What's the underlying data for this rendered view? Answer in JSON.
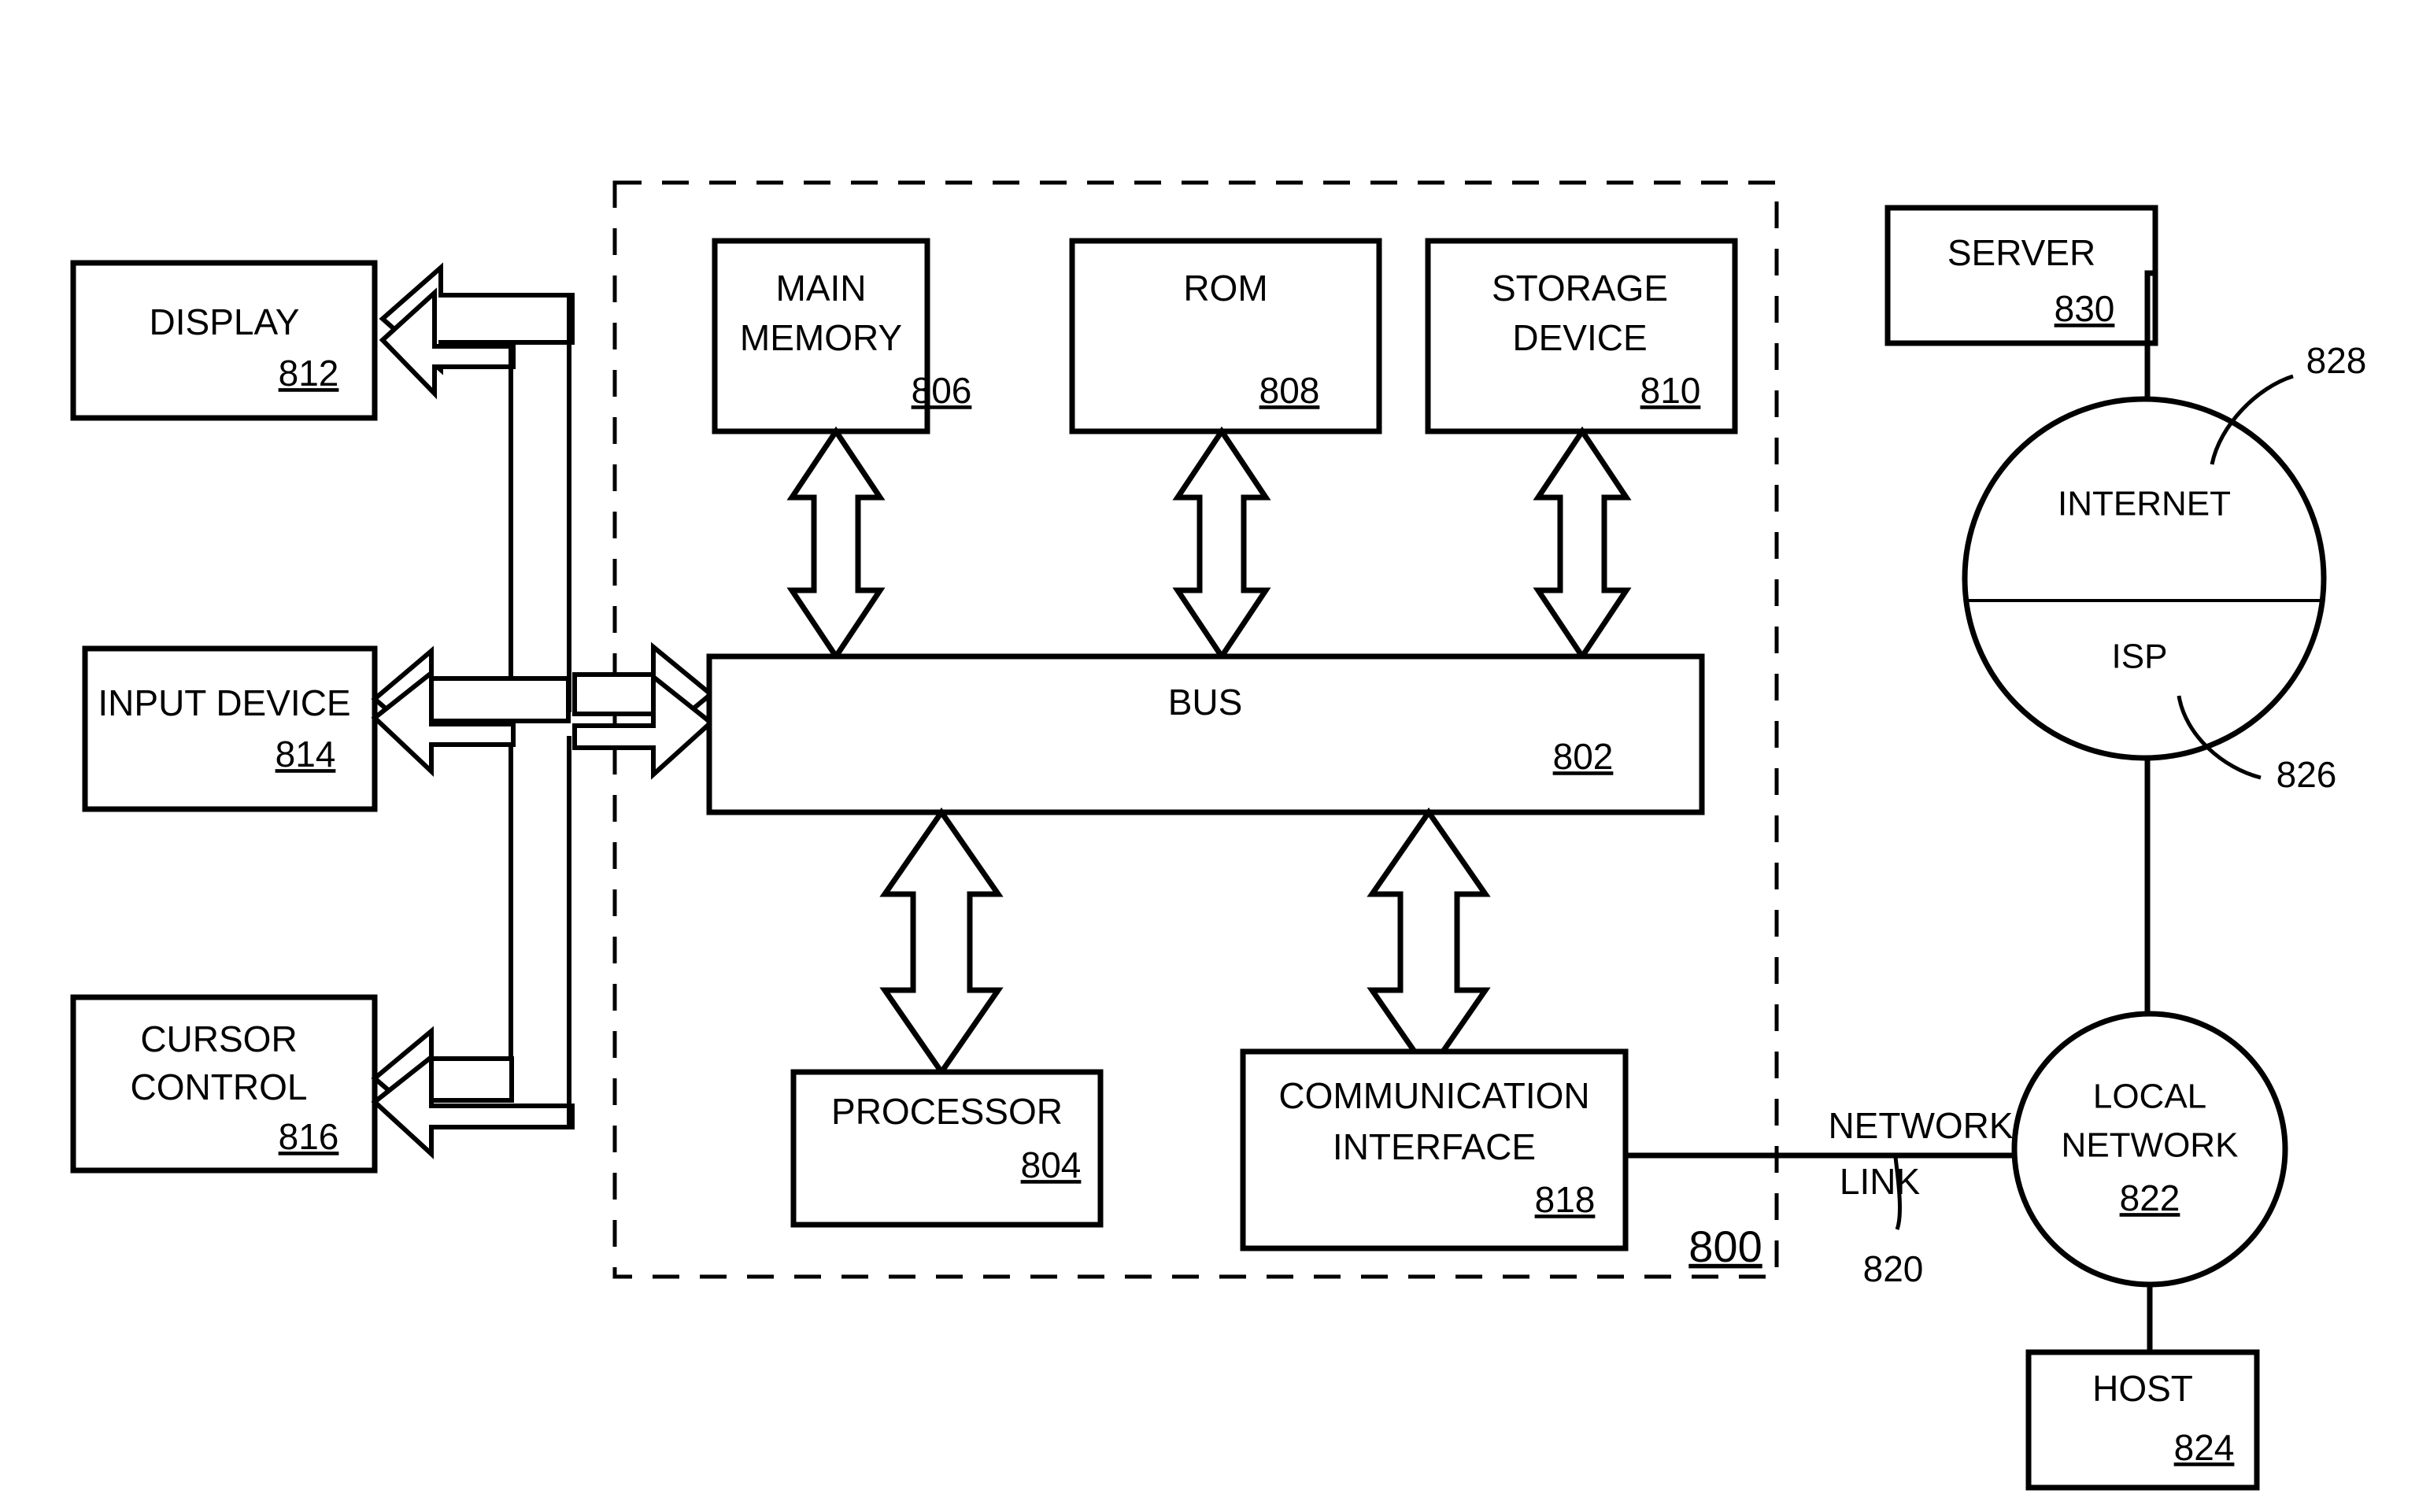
{
  "figure": {
    "type": "patent-block-diagram",
    "overall_reference": "800",
    "background_color": "#ffffff",
    "line_color": "#000000"
  },
  "peripherals": [
    {
      "id": "display",
      "label_lines": [
        "DISPLAY"
      ],
      "ref": "812"
    },
    {
      "id": "input-device",
      "label_lines": [
        "INPUT DEVICE"
      ],
      "ref": "814"
    },
    {
      "id": "cursor-control",
      "label_lines": [
        "CURSOR",
        "CONTROL"
      ],
      "ref": "816"
    }
  ],
  "memory_blocks": [
    {
      "id": "main-memory",
      "label_lines": [
        "MAIN",
        "MEMORY"
      ],
      "ref": "806"
    },
    {
      "id": "rom",
      "label_lines": [
        "ROM"
      ],
      "ref": "808"
    },
    {
      "id": "storage-device",
      "label_lines": [
        "STORAGE",
        "DEVICE"
      ],
      "ref": "810"
    }
  ],
  "bus": {
    "id": "bus",
    "label": "BUS",
    "ref": "802"
  },
  "lower_blocks": [
    {
      "id": "processor",
      "label_lines": [
        "PROCESSOR"
      ],
      "ref": "804"
    },
    {
      "id": "communication-interface",
      "label_lines": [
        "COMMUNICATION",
        "INTERFACE"
      ],
      "ref": "818"
    }
  ],
  "network": {
    "network_link": {
      "id": "network-link",
      "label_lines": [
        "NETWORK",
        "LINK"
      ],
      "ref": "820"
    },
    "local_network": {
      "id": "local-network",
      "label_lines": [
        "LOCAL",
        "NETWORK"
      ],
      "ref": "822"
    },
    "host": {
      "id": "host",
      "label_lines": [
        "HOST"
      ],
      "ref": "824"
    },
    "internet": {
      "id": "internet",
      "upper_label": "INTERNET",
      "lower_label": "ISP",
      "internet_ref": "828",
      "isp_ref": "826"
    },
    "server": {
      "id": "server",
      "label_lines": [
        "SERVER"
      ],
      "ref": "830"
    }
  },
  "icons": {
    "bidirectional_arrow": "double-headed-arrow-icon",
    "left_arrow": "left-arrow-icon",
    "right_arrow": "right-arrow-icon",
    "dashed_boundary": "dashed-boundary-icon"
  }
}
